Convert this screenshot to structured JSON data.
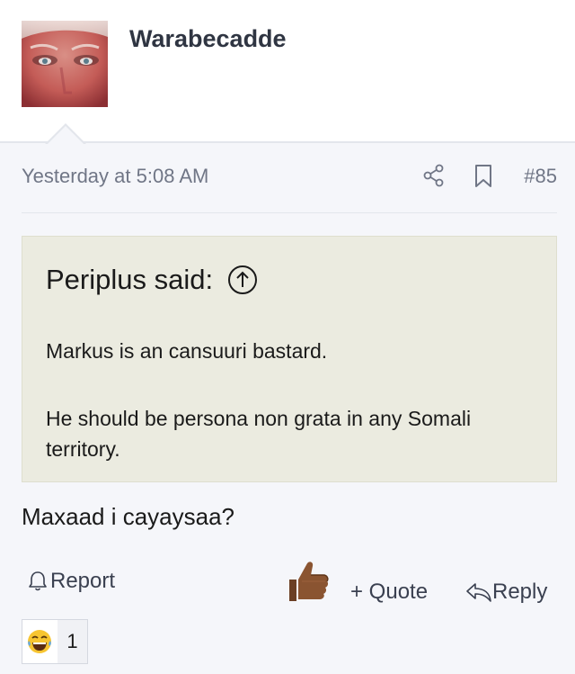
{
  "header": {
    "username": "Warabecadde",
    "avatar_icon": "user-avatar"
  },
  "meta": {
    "timestamp": "Yesterday at 5:08 AM",
    "post_number": "#85",
    "share_icon": "share-icon",
    "bookmark_icon": "bookmark-icon"
  },
  "quote": {
    "author": "Periplus said:",
    "lines": [
      "Markus is an cansuuri bastard.",
      "He should be persona non grata in any Somali territory."
    ]
  },
  "post": {
    "body": "Maxaad i cayaysaa?"
  },
  "actions": {
    "report": "Report",
    "quote": "+ Quote",
    "reply": "Reply",
    "like_icon": "thumbs-up-icon"
  },
  "reactions": {
    "emoji": "😂",
    "count": "1"
  },
  "colors": {
    "quote_bg": "#ebebe0",
    "username": "#2f3542",
    "muted": "#707686"
  }
}
